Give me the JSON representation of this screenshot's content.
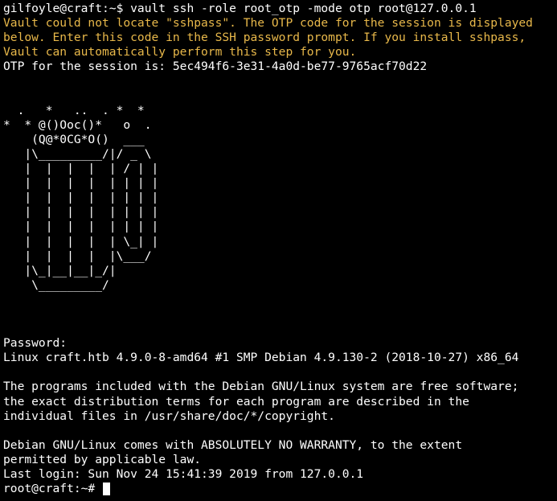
{
  "terminal": {
    "top_fragment": "gilfoyle@craft:~$ vault ssh -role root_otp -mode otp root@127.0.0.1",
    "command_line": "gilfoyle@craft:~$ vault ssh -role root_otp -mode otp root@127.0.0.1",
    "warning_lines": [
      "Vault could not locate \"sshpass\". The OTP code for the session is displayed",
      "below. Enter this code in the SSH password prompt. If you install sshpass,",
      "Vault can automatically perform this step for you."
    ],
    "otp_line": "OTP for the session is: 5ec494f6-3e31-4a0d-be77-9765acf70d22",
    "ascii_art": [
      "  .   *   ..  . *  *",
      "*  * @()Ooc()*   o  .",
      "    (Q@*0CG*O()  ___",
      "   |\\_________/|/ _ \\",
      "   |  |  |  |  | / | |",
      "   |  |  |  |  | | | |",
      "   |  |  |  |  | | | |",
      "   |  |  |  |  | | | |",
      "   |  |  |  |  | | | |",
      "   |  |  |  |  | \\_| |",
      "   |  |  |  |  |\\___/",
      "   |\\_|__|__|_/|",
      "    \\_________/"
    ],
    "password_prompt": "Password:",
    "system_info": "Linux craft.htb 4.9.0-8-amd64 #1 SMP Debian 4.9.130-2 (2018-10-27) x86_64",
    "motd_lines": [
      "The programs included with the Debian GNU/Linux system are free software;",
      "the exact distribution terms for each program are described in the",
      "individual files in /usr/share/doc/*/copyright."
    ],
    "warranty_lines": [
      "Debian GNU/Linux comes with ABSOLUTELY NO WARRANTY, to the extent",
      "permitted by applicable law."
    ],
    "last_login": "Last login: Sun Nov 24 15:41:39 2019 from 127.0.0.1",
    "root_prompt": "root@craft:~# "
  },
  "colors": {
    "background": "#000000",
    "foreground": "#ffffff",
    "warning": "#e8b84a"
  }
}
